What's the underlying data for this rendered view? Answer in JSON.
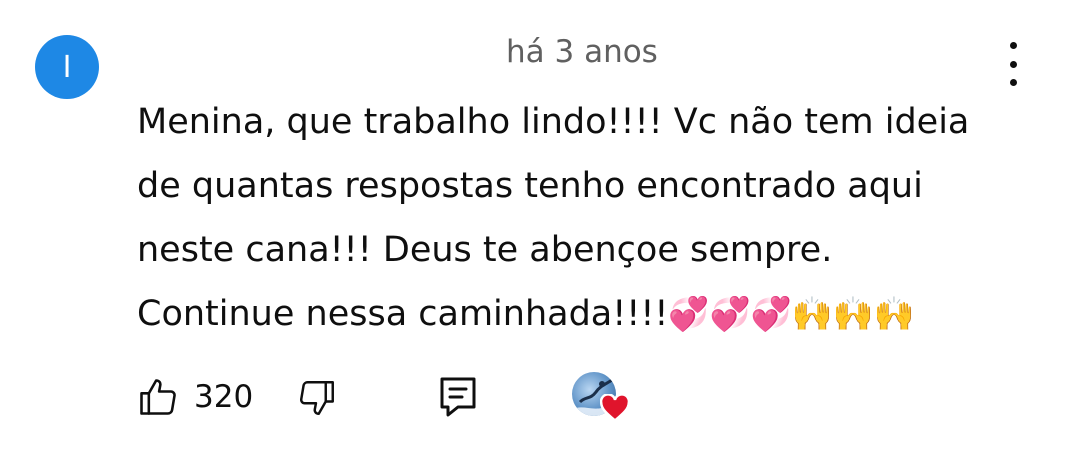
{
  "comment": {
    "author_initial": "I",
    "timestamp": "há 3 anos",
    "text_lines": [
      "Menina, que trabalho lindo!!!! Vc não tem ideia",
      "de quantas respostas tenho encontrado aqui",
      "neste cana!!! Deus te abençoe sempre.",
      "Continue nessa caminhada!!!!"
    ],
    "trailing_emoji": "💞💞💞🙌🙌🙌"
  },
  "actions": {
    "like_count": "320"
  },
  "colors": {
    "avatar_bg": "#1e88e5",
    "timestamp": "#606060",
    "text": "#0f0f0f",
    "heart": "#e0142c"
  },
  "icons": [
    "more-vert-icon",
    "thumbs-up-icon",
    "thumbs-down-icon",
    "reply-icon",
    "creator-heart-icon"
  ]
}
